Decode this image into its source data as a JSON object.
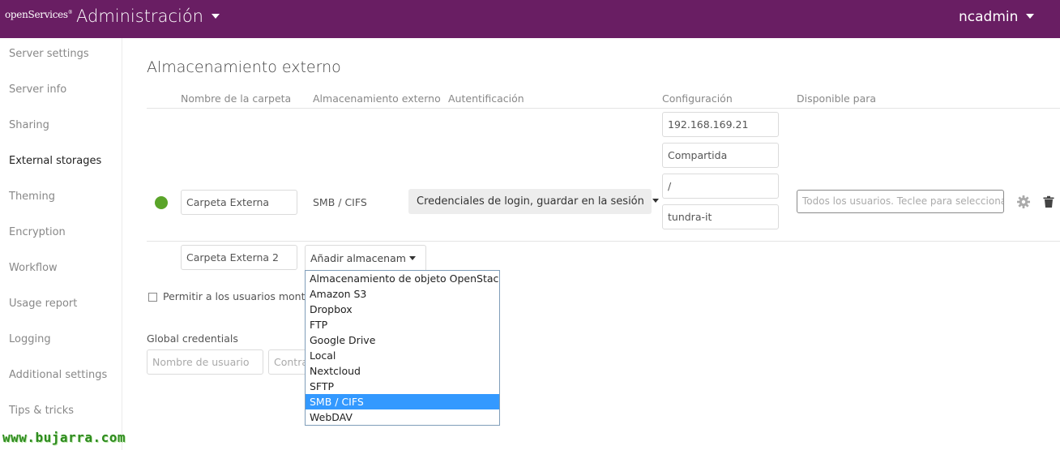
{
  "header": {
    "logo_text": "openServices",
    "app_title": "Administración",
    "user_name": "ncadmin"
  },
  "sidebar": {
    "items": [
      {
        "label": "Server settings"
      },
      {
        "label": "Server info"
      },
      {
        "label": "Sharing"
      },
      {
        "label": "External storages",
        "active": true
      },
      {
        "label": "Theming"
      },
      {
        "label": "Encryption"
      },
      {
        "label": "Workflow"
      },
      {
        "label": "Usage report"
      },
      {
        "label": "Logging"
      },
      {
        "label": "Additional settings"
      },
      {
        "label": "Tips & tricks"
      }
    ]
  },
  "main": {
    "title": "Almacenamiento externo",
    "columns": {
      "folder_name": "Nombre de la carpeta",
      "external_storage": "Almacenamiento externo",
      "authentication": "Autentificación",
      "configuration": "Configuración",
      "available_for": "Disponible para"
    },
    "mount_row": {
      "status": "ok",
      "folder_name": "Carpeta Externa",
      "storage_type": "SMB / CIFS",
      "auth_method": "Credenciales de login, guardar en la sesión",
      "config": {
        "host": "192.168.169.21",
        "share": "Compartida",
        "remote_subfolder": "/",
        "domain": "tundra-it"
      },
      "applicable_placeholder": "Todos los usuarios. Teclee para seleccionar"
    },
    "new_row": {
      "folder_name": "Carpeta Externa 2",
      "add_storage_label": "Añadir almacenamiento"
    },
    "storage_options": [
      "Almacenamiento de objeto OpenStack",
      "Amazon S3",
      "Dropbox",
      "FTP",
      "Google Drive",
      "Local",
      "Nextcloud",
      "SFTP",
      "SMB / CIFS",
      "WebDAV"
    ],
    "selected_option_index": 8,
    "allow_users_label": "Permitir a los usuarios montar almacenamiento externo",
    "allow_users_checked": false,
    "global_credentials": {
      "label": "Global credentials",
      "username_placeholder": "Nombre de usuario",
      "password_placeholder": "Contraseña"
    }
  },
  "watermark": "www.bujarra.com",
  "colors": {
    "header_bg": "#691e63",
    "status_ok": "#5aa429",
    "dropdown_selected": "#3399ff"
  }
}
